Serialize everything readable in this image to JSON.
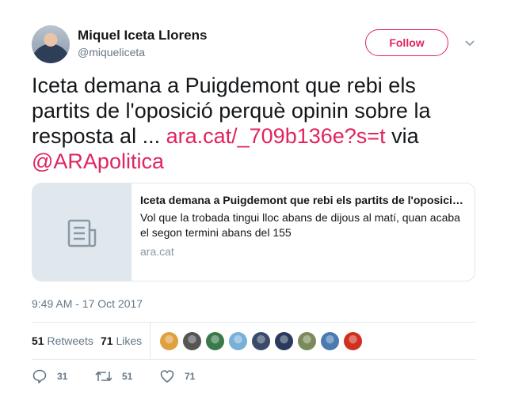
{
  "user": {
    "name": "Miquel Iceta Llorens",
    "handle": "@miqueliceta"
  },
  "follow_label": "Follow",
  "tweet": {
    "text_plain": "Iceta demana a Puigdemont que rebi els partits de l'oposició perquè opinin sobre la resposta al ... ",
    "link": "ara.cat/_709b136e?s=t",
    "via": " via ",
    "mention": "@ARApolitica"
  },
  "card": {
    "title": "Iceta demana a Puigdemont que rebi els partits de l'oposició perquè opinin sobre la resposta al requeriment",
    "description": "Vol que la trobada tingui lloc abans de dijous al matí, quan acaba el segon termini abans del 155",
    "domain": "ara.cat",
    "icon": "document-icon"
  },
  "timestamp": "9:49 AM - 17 Oct 2017",
  "stats": {
    "retweets_count": "51",
    "retweets_label": "Retweets",
    "likes_count": "71",
    "likes_label": "Likes"
  },
  "liker_avatar_colors": [
    "#e0a040",
    "#555555",
    "#3a7a4a",
    "#7ab0d8",
    "#3a4a6a",
    "#2a3a5a",
    "#7a8a5a",
    "#4a7ab0",
    "#d03020"
  ],
  "actions": {
    "reply_count": "31",
    "retweet_count": "51",
    "like_count": "71"
  },
  "colors": {
    "accent": "#e0245e",
    "muted": "#657786",
    "border": "#e1e8ed"
  }
}
